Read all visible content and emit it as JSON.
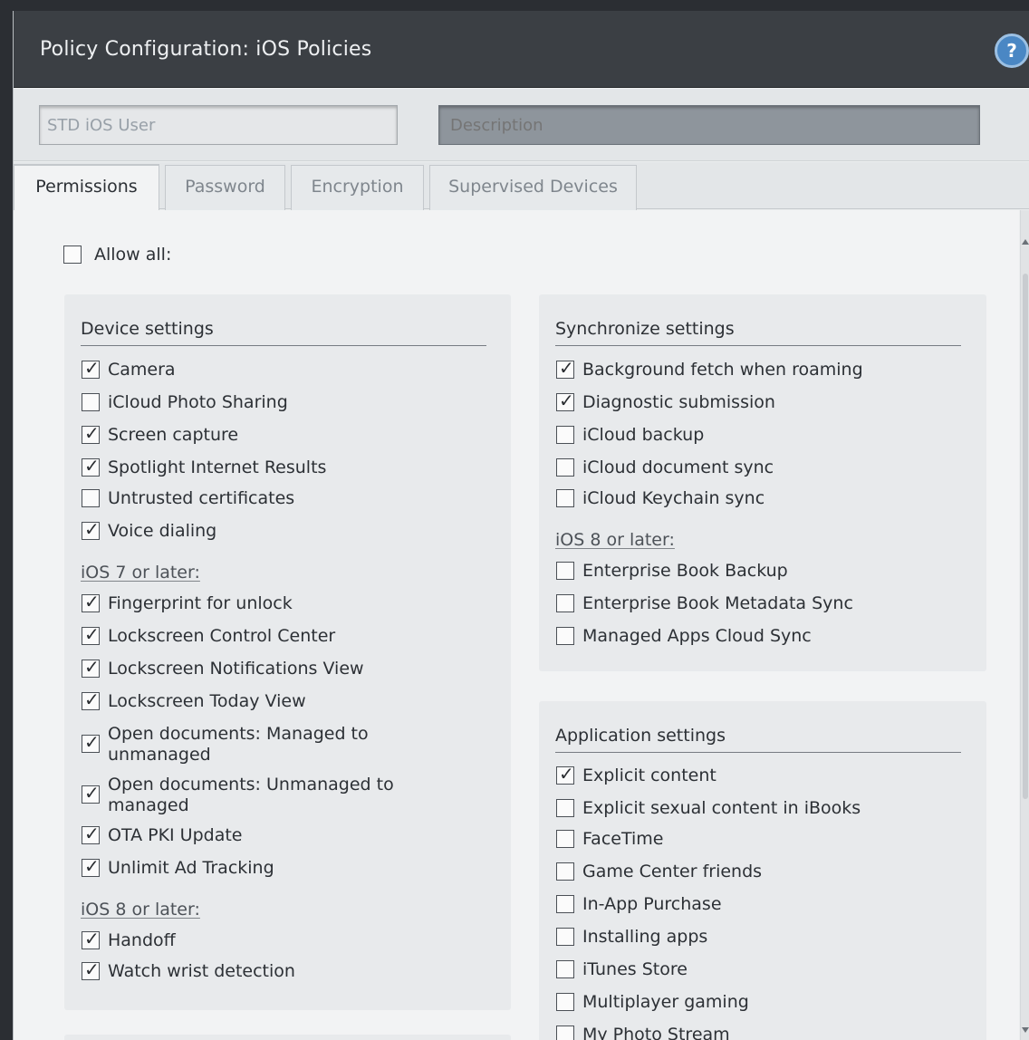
{
  "window": {
    "title": "Policy Configuration: iOS Policies",
    "help_label": "?"
  },
  "fields": {
    "name_value": "STD iOS User",
    "description_placeholder": "Description"
  },
  "tabs": [
    {
      "label": "Permissions",
      "active": true
    },
    {
      "label": "Password",
      "active": false
    },
    {
      "label": "Encryption",
      "active": false
    },
    {
      "label": "Supervised Devices",
      "active": false
    }
  ],
  "allow_all": {
    "label": "Allow all:",
    "checked": false
  },
  "device": {
    "heading": "Device settings",
    "items": [
      {
        "label": "Camera",
        "checked": true
      },
      {
        "label": "iCloud Photo Sharing",
        "checked": false
      },
      {
        "label": "Screen capture",
        "checked": true
      },
      {
        "label": "Spotlight Internet Results",
        "checked": true
      },
      {
        "label": "Untrusted certificates",
        "checked": false
      },
      {
        "label": "Voice dialing",
        "checked": true
      }
    ],
    "ios7_heading": "iOS 7 or later:",
    "ios7_items": [
      {
        "label": "Fingerprint for unlock",
        "checked": true
      },
      {
        "label": "Lockscreen Control Center",
        "checked": true
      },
      {
        "label": "Lockscreen Notifications View",
        "checked": true
      },
      {
        "label": "Lockscreen Today View",
        "checked": true
      },
      {
        "label": "Open documents: Managed to unmanaged",
        "checked": true
      },
      {
        "label": "Open documents: Unmanaged to managed",
        "checked": true
      },
      {
        "label": "OTA PKI Update",
        "checked": true
      },
      {
        "label": "Unlimit Ad Tracking",
        "checked": true
      }
    ],
    "ios8_heading": "iOS 8 or later:",
    "ios8_items": [
      {
        "label": "Handoff",
        "checked": true
      },
      {
        "label": "Watch wrist detection",
        "checked": true
      }
    ]
  },
  "sync": {
    "heading": "Synchronize settings",
    "items": [
      {
        "label": "Background fetch when roaming",
        "checked": true
      },
      {
        "label": "Diagnostic submission",
        "checked": true
      },
      {
        "label": "iCloud backup",
        "checked": false
      },
      {
        "label": "iCloud document sync",
        "checked": false
      },
      {
        "label": "iCloud Keychain sync",
        "checked": false
      }
    ],
    "ios8_heading": "iOS 8 or later:",
    "ios8_items": [
      {
        "label": "Enterprise Book Backup",
        "checked": false
      },
      {
        "label": "Enterprise Book Metadata Sync",
        "checked": false
      },
      {
        "label": "Managed Apps Cloud Sync",
        "checked": false
      }
    ]
  },
  "app": {
    "heading": "Application settings",
    "items": [
      {
        "label": "Explicit content",
        "checked": true
      },
      {
        "label": "Explicit sexual content in iBooks",
        "checked": false
      },
      {
        "label": "FaceTime",
        "checked": false
      },
      {
        "label": "Game Center friends",
        "checked": false
      },
      {
        "label": "In-App Purchase",
        "checked": false
      },
      {
        "label": "Installing apps",
        "checked": false
      },
      {
        "label": "iTunes Store",
        "checked": false
      },
      {
        "label": "Multiplayer gaming",
        "checked": false
      },
      {
        "label": "My Photo Stream",
        "checked": false
      }
    ]
  }
}
